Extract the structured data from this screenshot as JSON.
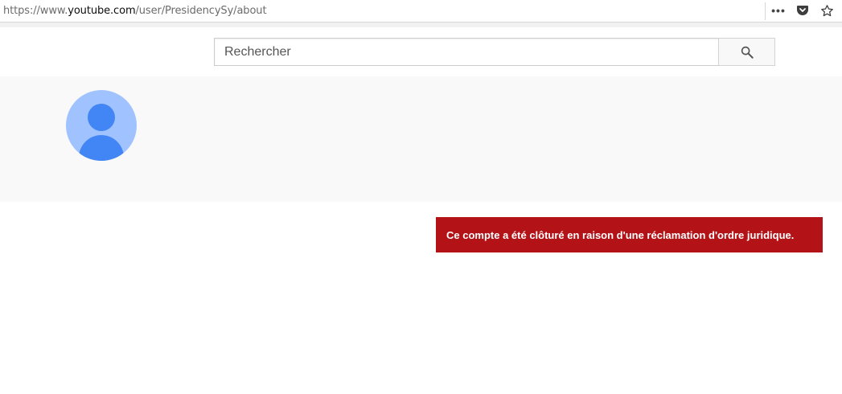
{
  "browser": {
    "url_prefix": "https://www.",
    "url_host": "youtube.com",
    "url_path": "/user/PresidencySy/about",
    "more_label": "•••",
    "pocket_icon": "pocket-icon",
    "bookmark_icon": "star-icon"
  },
  "search": {
    "placeholder": "Rechercher",
    "button_icon": "search-icon"
  },
  "channel": {
    "avatar_icon": "default-user-avatar"
  },
  "alert": {
    "message": "Ce compte a été clôturé en raison d'une réclamation d'ordre juridique.",
    "color": "#b31217"
  }
}
